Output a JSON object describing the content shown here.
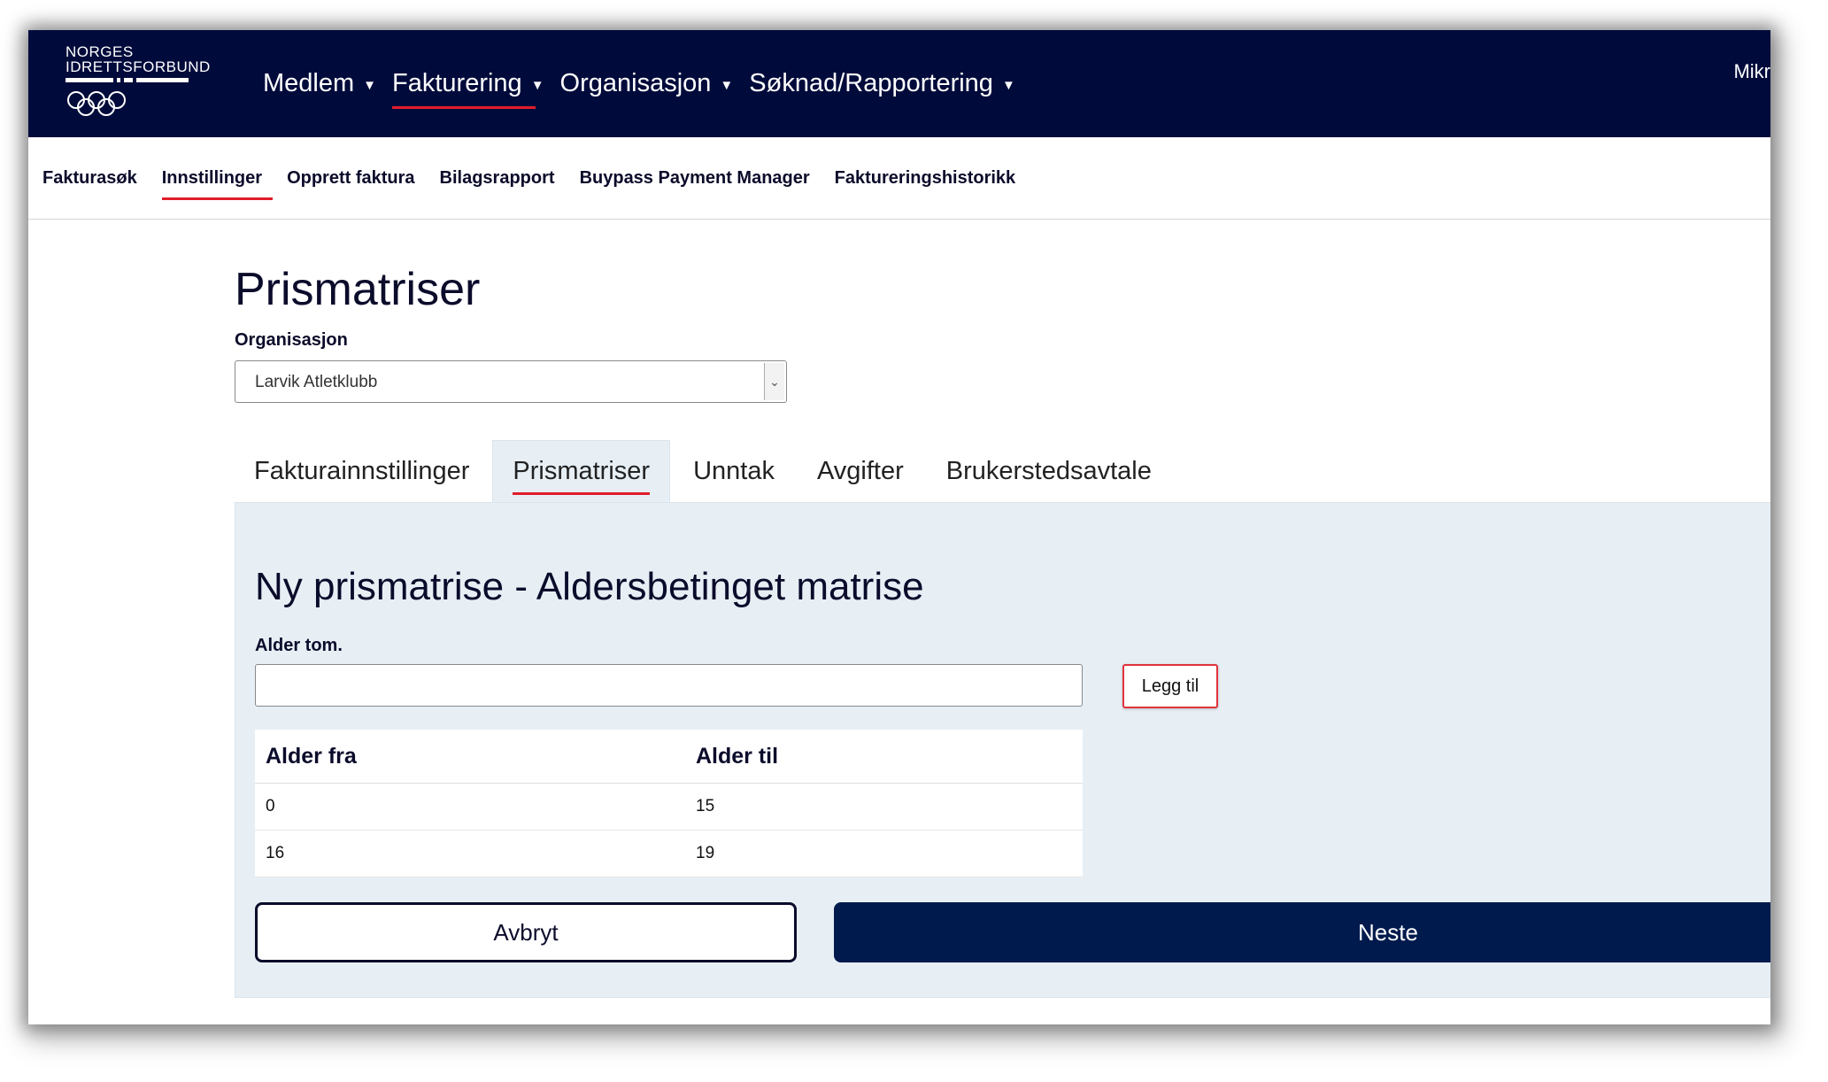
{
  "header": {
    "logo_line1": "NORGES",
    "logo_line2": "IDRETTSFORBUND",
    "nav": [
      {
        "label": "Medlem"
      },
      {
        "label": "Fakturering"
      },
      {
        "label": "Organisasjon"
      },
      {
        "label": "Søknad/Rapportering"
      }
    ],
    "user_label": "Mikr"
  },
  "subnav": {
    "items": [
      {
        "label": "Fakturasøk"
      },
      {
        "label": "Innstillinger"
      },
      {
        "label": "Opprett faktura"
      },
      {
        "label": "Bilagsrapport"
      },
      {
        "label": "Buypass Payment Manager"
      },
      {
        "label": "Faktureringshistorikk"
      }
    ]
  },
  "page": {
    "title": "Prismatriser",
    "org_label": "Organisasjon",
    "org_value": "Larvik Atletklubb"
  },
  "tabs": [
    {
      "label": "Fakturainnstillinger"
    },
    {
      "label": "Prismatriser"
    },
    {
      "label": "Unntak"
    },
    {
      "label": "Avgifter"
    },
    {
      "label": "Brukerstedsavtale"
    }
  ],
  "panel": {
    "heading": "Ny prismatrise - Aldersbetinget matrise",
    "age_label": "Alder tom.",
    "age_value": "",
    "add_label": "Legg til",
    "table": {
      "col_from": "Alder fra",
      "col_to": "Alder til",
      "rows": [
        {
          "from": "0",
          "to": "15"
        },
        {
          "from": "16",
          "to": "19"
        }
      ]
    },
    "cancel_label": "Avbryt",
    "next_label": "Neste"
  },
  "colors": {
    "header_bg": "#000b3b",
    "accent_red": "#e11d2b",
    "panel_bg": "#e7eff5",
    "primary_button": "#001a4d"
  }
}
